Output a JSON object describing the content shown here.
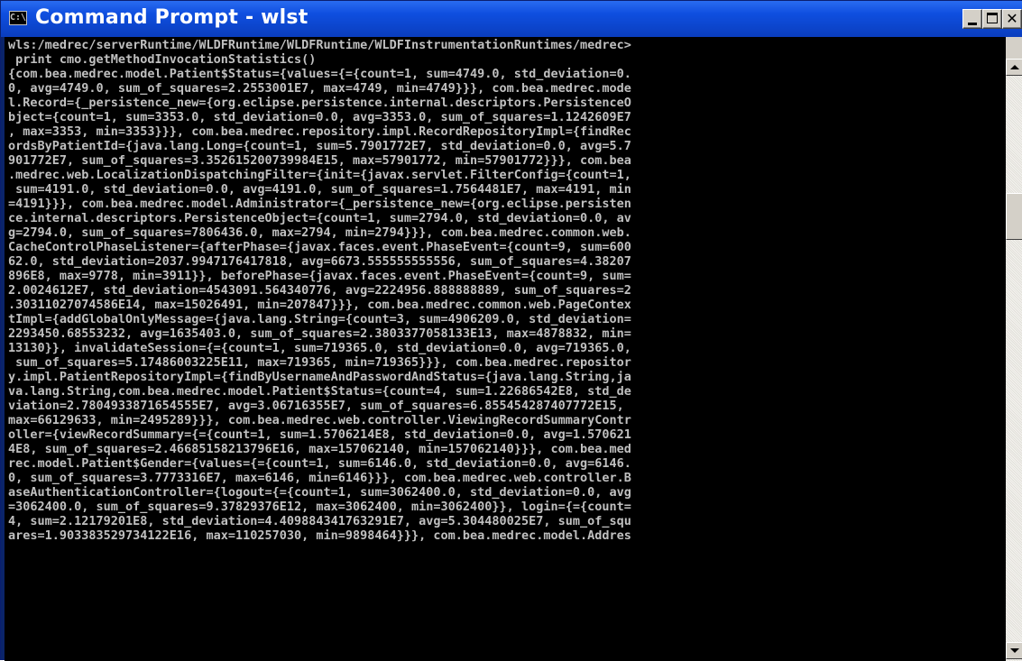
{
  "window": {
    "title": "Command Prompt - wlst",
    "icon": "console-icon",
    "icon_glyph": "C:\\",
    "controls": [
      "minimize",
      "maximize",
      "close"
    ],
    "close_glyph": "✕"
  },
  "console": {
    "lines": [
      "wls:/medrec/serverRuntime/WLDFRuntime/WLDFRuntime/WLDFInstrumentationRuntimes/medrec>",
      " print cmo.getMethodInvocationStatistics()",
      "{com.bea.medrec.model.Patient$Status={values={={count=1, sum=4749.0, std_deviation=0.",
      "0, avg=4749.0, sum_of_squares=2.2553001E7, max=4749, min=4749}}}, com.bea.medrec.mode",
      "l.Record={_persistence_new={org.eclipse.persistence.internal.descriptors.PersistenceO",
      "bject={count=1, sum=3353.0, std_deviation=0.0, avg=3353.0, sum_of_squares=1.1242609E7",
      ", max=3353, min=3353}}}, com.bea.medrec.repository.impl.RecordRepositoryImpl={findRec",
      "ordsByPatientId={java.lang.Long={count=1, sum=5.7901772E7, std_deviation=0.0, avg=5.7",
      "901772E7, sum_of_squares=3.352615200739984E15, max=57901772, min=57901772}}}, com.bea",
      ".medrec.web.LocalizationDispatchingFilter={init={javax.servlet.FilterConfig={count=1,",
      " sum=4191.0, std_deviation=0.0, avg=4191.0, sum_of_squares=1.7564481E7, max=4191, min",
      "=4191}}}, com.bea.medrec.model.Administrator={_persistence_new={org.eclipse.persisten",
      "ce.internal.descriptors.PersistenceObject={count=1, sum=2794.0, std_deviation=0.0, av",
      "g=2794.0, sum_of_squares=7806436.0, max=2794, min=2794}}}, com.bea.medrec.common.web.",
      "CacheControlPhaseListener={afterPhase={javax.faces.event.PhaseEvent={count=9, sum=600",
      "62.0, std_deviation=2037.9947176417818, avg=6673.555555555556, sum_of_squares=4.38207",
      "896E8, max=9778, min=3911}}, beforePhase={javax.faces.event.PhaseEvent={count=9, sum=",
      "2.0024612E7, std_deviation=4543091.564340776, avg=2224956.888888889, sum_of_squares=2",
      ".30311027074586E14, max=15026491, min=207847}}}, com.bea.medrec.common.web.PageContex",
      "tImpl={addGlobalOnlyMessage={java.lang.String={count=3, sum=4906209.0, std_deviation=",
      "2293450.68553232, avg=1635403.0, sum_of_squares=2.3803377058133E13, max=4878832, min=",
      "13130}}, invalidateSession={={count=1, sum=719365.0, std_deviation=0.0, avg=719365.0,",
      " sum_of_squares=5.17486003225E11, max=719365, min=719365}}}, com.bea.medrec.repositor",
      "y.impl.PatientRepositoryImpl={findByUsernameAndPasswordAndStatus={java.lang.String,ja",
      "va.lang.String,com.bea.medrec.model.Patient$Status={count=4, sum=1.22686542E8, std_de",
      "viation=2.7804933871654555E7, avg=3.06716355E7, sum_of_squares=6.855454287407772E15,",
      "max=66129633, min=2495289}}}, com.bea.medrec.web.controller.ViewingRecordSummaryContr",
      "oller={viewRecordSummary={={count=1, sum=1.5706214E8, std_deviation=0.0, avg=1.570621",
      "4E8, sum_of_squares=2.46685158213796E16, max=157062140, min=157062140}}}, com.bea.med",
      "rec.model.Patient$Gender={values={={count=1, sum=6146.0, std_deviation=0.0, avg=6146.",
      "0, sum_of_squares=3.7773316E7, max=6146, min=6146}}}, com.bea.medrec.web.controller.B",
      "aseAuthenticationController={logout={={count=1, sum=3062400.0, std_deviation=0.0, avg",
      "=3062400.0, sum_of_squares=9.37829376E12, max=3062400, min=3062400}}, login={={count=",
      "4, sum=2.12179201E8, std_deviation=4.409884341763291E7, avg=5.304480025E7, sum_of_squ",
      "ares=1.903383529734122E16, max=110257030, min=9898464}}}, com.bea.medrec.model.Addres"
    ]
  },
  "colors": {
    "titlebar": "#0a3dbd",
    "console_bg": "#000000",
    "console_fg": "#c0c0c0"
  }
}
